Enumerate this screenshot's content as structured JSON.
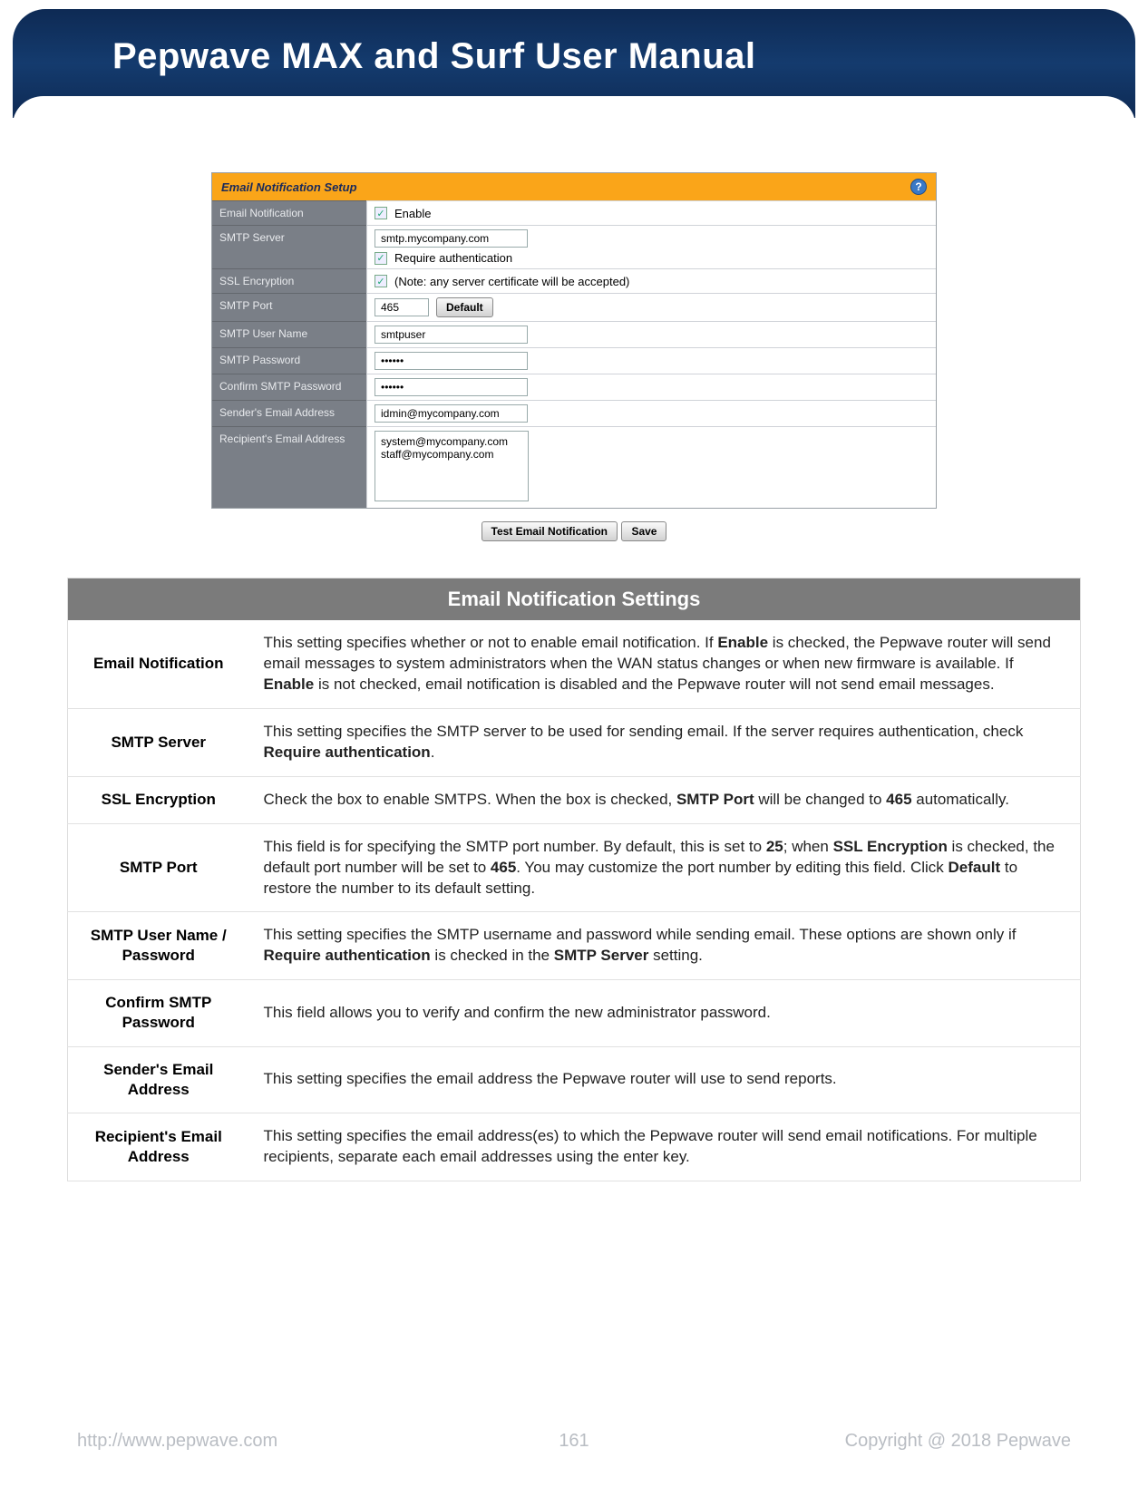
{
  "header": {
    "title": "Pepwave MAX and Surf User Manual"
  },
  "screenshot": {
    "panel_title": "Email Notification Setup",
    "rows": {
      "email_notification": {
        "label": "Email Notification",
        "enable_text": "Enable"
      },
      "smtp_server": {
        "label": "SMTP Server",
        "value": "smtp.mycompany.com",
        "require_auth_text": "Require authentication"
      },
      "ssl_encryption": {
        "label": "SSL Encryption",
        "note": "(Note: any server certificate will be accepted)"
      },
      "smtp_port": {
        "label": "SMTP Port",
        "value": "465",
        "default_btn": "Default"
      },
      "smtp_user": {
        "label": "SMTP User Name",
        "value": "smtpuser"
      },
      "smtp_pass": {
        "label": "SMTP Password",
        "value": "••••••"
      },
      "confirm_pass": {
        "label": "Confirm SMTP Password",
        "value": "••••••"
      },
      "sender": {
        "label": "Sender's Email Address",
        "value": "idmin@mycompany.com"
      },
      "recipient": {
        "label": "Recipient's Email Address",
        "value": "system@mycompany.com\nstaff@mycompany.com"
      }
    },
    "buttons": {
      "test": "Test Email Notification",
      "save": "Save"
    }
  },
  "settings": {
    "title": "Email Notification Settings",
    "items": [
      {
        "name": "Email Notification",
        "desc_html": "This setting specifies whether or not to enable email notification. If <b>Enable</b> is checked, the Pepwave router will send email messages to system administrators when the WAN status changes or when new firmware is available. If  <b>Enable</b> is not checked, email notification is disabled and the Pepwave router will not send email messages."
      },
      {
        "name": "SMTP Server",
        "desc_html": "This setting specifies the SMTP server to be used for sending email. If the server requires authentication, check <b>Require authentication</b>."
      },
      {
        "name": "SSL Encryption",
        "desc_html": "Check the box to enable SMTPS.  When the box is checked, <b>SMTP Port</b> will be changed to <b>465</b> automatically."
      },
      {
        "name": "SMTP Port",
        "desc_html": "This field is for specifying the SMTP port number. By default, this is set to <b>25</b>; when <b>SSL Encryption</b> is checked, the default port number will be set to <b>465</b>. You may customize the port number by editing this field. Click <b>Default</b> to restore the number to its default setting."
      },
      {
        "name": "SMTP User Name / Password",
        "desc_html": "This setting specifies the SMTP username and password while sending email. These options are shown only if <b>Require authentication</b> is checked in the <b>SMTP Server</b> setting."
      },
      {
        "name": "Confirm SMTP Password",
        "desc_html": "This field allows you to verify and confirm the new administrator password."
      },
      {
        "name": "Sender's Email Address",
        "desc_html": "This setting specifies the email address the Pepwave router will use to send reports."
      },
      {
        "name": "Recipient's Email Address",
        "desc_html": "This setting specifies the email address(es) to which the Pepwave router will send email notifications. For multiple recipients, separate each email addresses using the enter key."
      }
    ]
  },
  "footer": {
    "url": "http://www.pepwave.com",
    "page": "161",
    "copyright": "Copyright @ 2018 Pepwave"
  }
}
